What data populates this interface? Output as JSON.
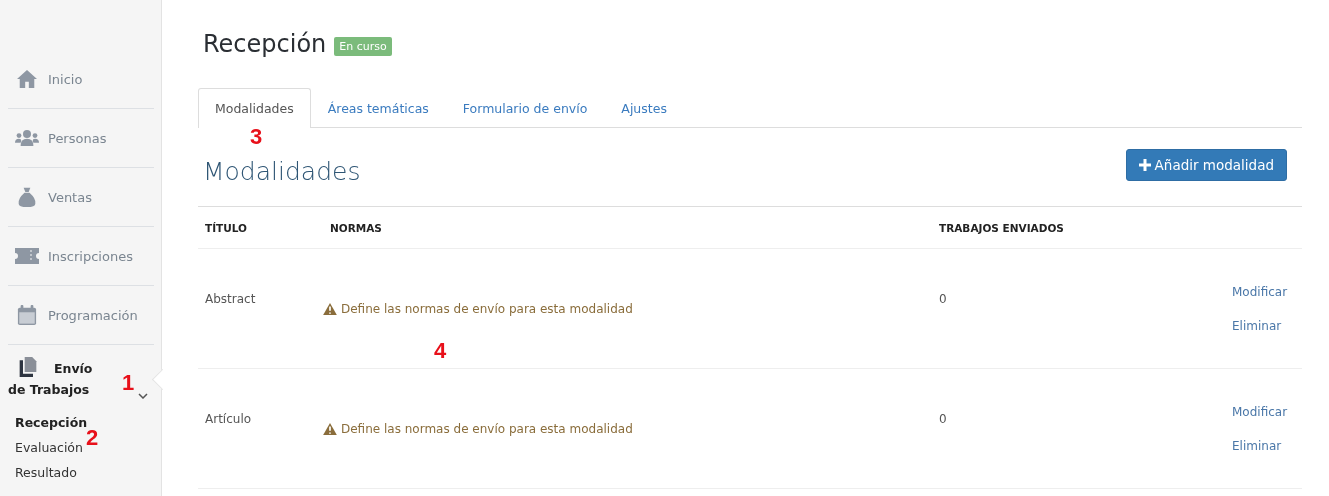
{
  "sidebar": {
    "items": [
      {
        "label": "Inicio",
        "selected": false,
        "expanded": false
      },
      {
        "label": "Personas",
        "selected": false,
        "expanded": false
      },
      {
        "label": "Ventas",
        "selected": false,
        "expanded": false
      },
      {
        "label": "Inscripciones",
        "selected": false,
        "expanded": false
      },
      {
        "label": "Programación",
        "selected": false,
        "expanded": false
      },
      {
        "label": "Envío de Trabajos",
        "selected": true,
        "expanded": true,
        "children": [
          {
            "label": "Recepción",
            "selected": true
          },
          {
            "label": "Evaluación",
            "selected": false
          },
          {
            "label": "Resultado",
            "selected": false
          }
        ]
      }
    ]
  },
  "page": {
    "title": "Recepción",
    "status_badge": "En curso"
  },
  "tabs": [
    {
      "label": "Modalidades",
      "selected": true
    },
    {
      "label": "Áreas temáticas",
      "selected": false
    },
    {
      "label": "Formulario de envío",
      "selected": false
    },
    {
      "label": "Ajustes",
      "selected": false
    }
  ],
  "section": {
    "heading": "Modalidades",
    "add_button": "Añadir modalidad"
  },
  "table": {
    "columns": [
      "TÍTULO",
      "NORMAS",
      "TRABAJOS ENVIADOS"
    ],
    "rows": [
      {
        "title": "Abstract",
        "rules": "Define las normas de envío para esta modalidad",
        "rules_warning": true,
        "submitted": "0",
        "actions": [
          "Modificar",
          "Eliminar"
        ]
      },
      {
        "title": "Artículo",
        "rules": "Define las normas de envío para esta modalidad",
        "rules_warning": true,
        "submitted": "0",
        "actions": [
          "Modificar",
          "Eliminar"
        ]
      }
    ]
  },
  "annotations": [
    "1",
    "2",
    "3",
    "4"
  ]
}
